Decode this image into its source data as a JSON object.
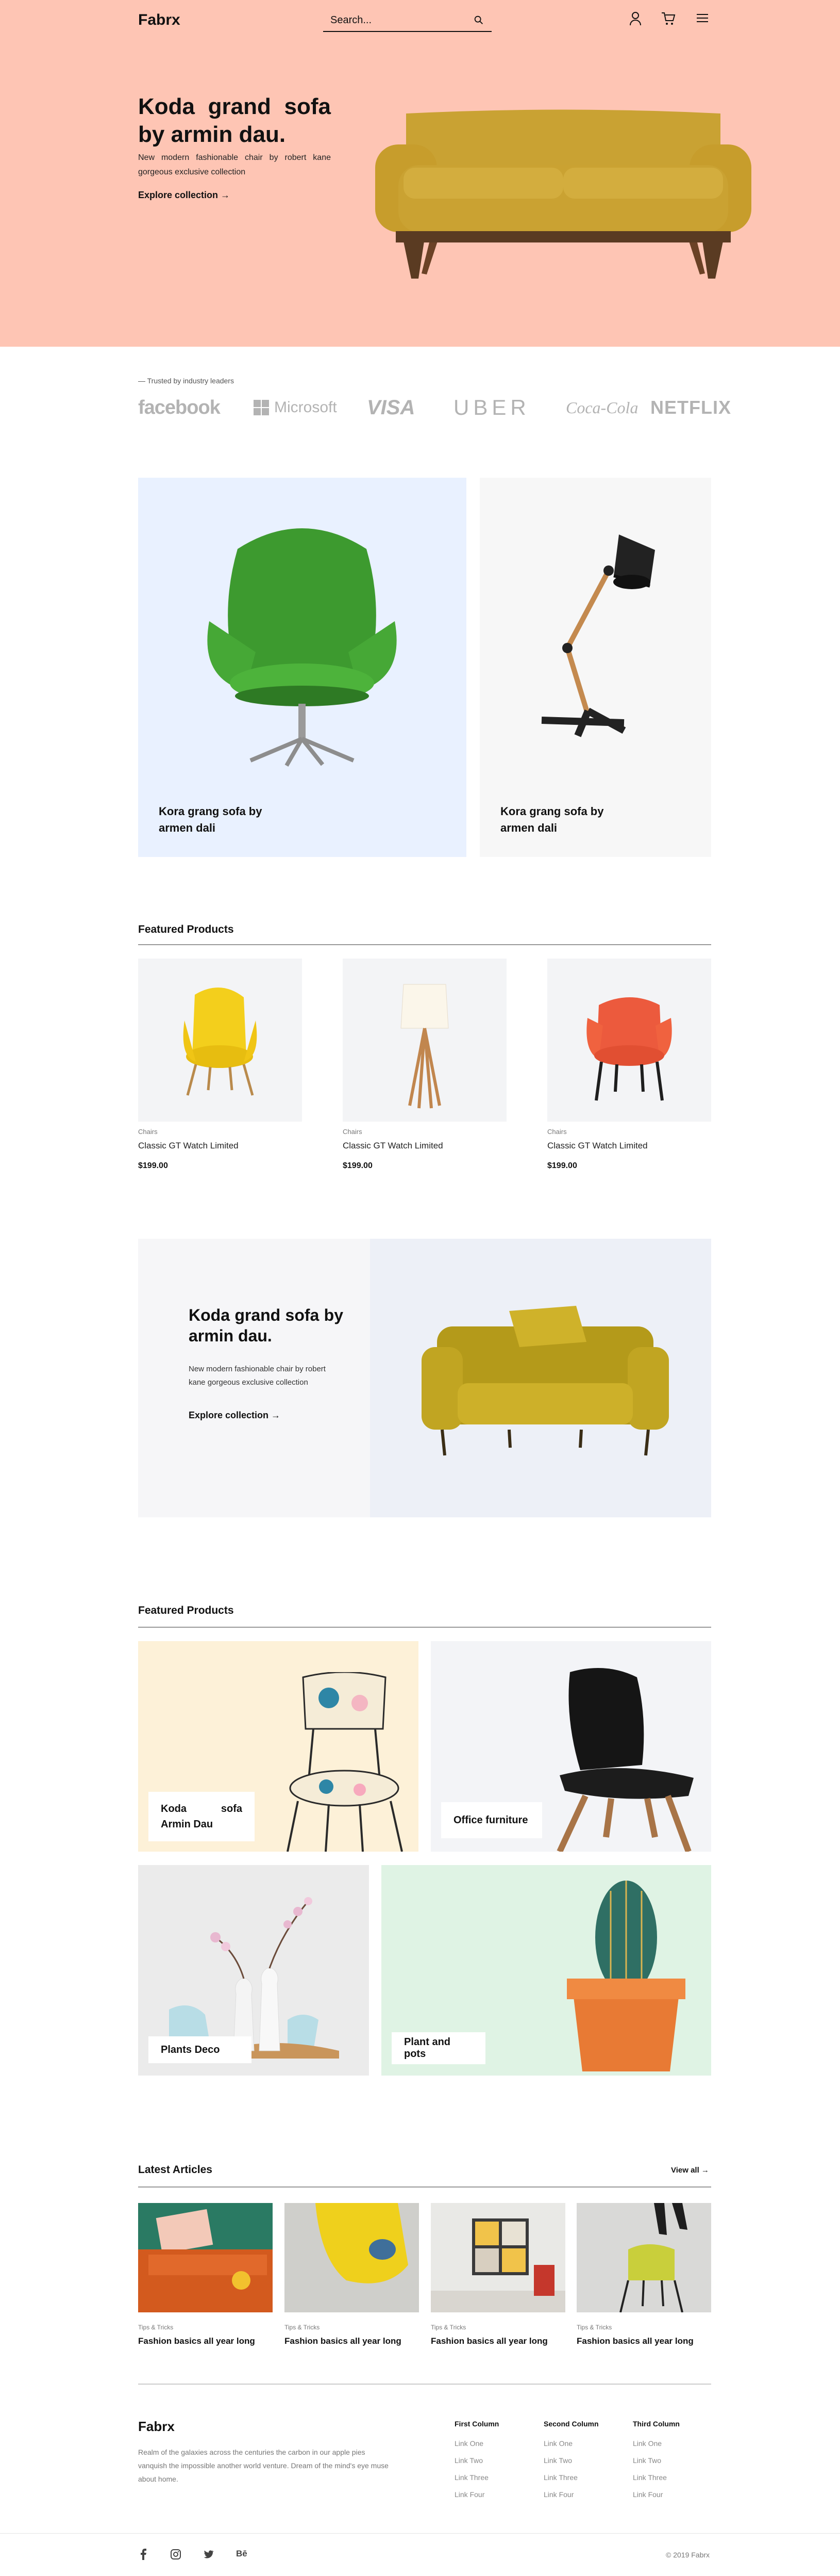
{
  "header": {
    "logo": "Fabrx",
    "search_placeholder": "Search...",
    "icons": [
      "search-icon",
      "user-icon",
      "cart-icon",
      "menu-icon"
    ]
  },
  "hero": {
    "title": "Koda grand sofa by armin dau.",
    "subtitle": "New modern fashionable chair by robert kane gorgeous exclusive collection",
    "cta": "Explore collection →",
    "background": "#fec5b4"
  },
  "trusted": {
    "label": "— Trusted by industry leaders",
    "brands": [
      "facebook",
      "Microsoft",
      "VISA",
      "UBER",
      "Coca-Cola",
      "NETFLIX"
    ]
  },
  "showcase": [
    {
      "caption_line1": "Kora grang sofa by",
      "caption_line2": "armen dali",
      "background": "#e9f1ff"
    },
    {
      "caption_line1": "Kora grang sofa by",
      "caption_line2": "armen dali",
      "background": "#f7f7f7"
    }
  ],
  "featured1": {
    "title": "Featured Products",
    "products": [
      {
        "category": "Chairs",
        "name": "Classic GT Watch Limited",
        "price": "$199.00"
      },
      {
        "category": "Chairs",
        "name": "Classic GT Watch Limited",
        "price": "$199.00"
      },
      {
        "category": "Chairs",
        "name": "Classic GT Watch Limited",
        "price": "$199.00"
      }
    ]
  },
  "promo": {
    "title": "Koda grand sofa by armin dau.",
    "subtitle": "New modern fashionable chair by robert kane gorgeous exclusive collection",
    "cta": "Explore collection →"
  },
  "featured2": {
    "title": "Featured Products",
    "tiles": [
      {
        "label_line1": "Koda sofa",
        "label_line2": "Armin Dau"
      },
      {
        "label": "Office furniture"
      },
      {
        "label": "Plants Deco"
      },
      {
        "label": "Plant and pots"
      }
    ]
  },
  "articles": {
    "title": "Latest Articles",
    "view_all": "View all →",
    "items": [
      {
        "category": "Tips & Tricks",
        "title": "Fashion basics all year long"
      },
      {
        "category": "Tips & Tricks",
        "title": "Fashion basics all year long"
      },
      {
        "category": "Tips & Tricks",
        "title": "Fashion basics all year long"
      },
      {
        "category": "Tips & Tricks",
        "title": "Fashion basics all year long"
      }
    ]
  },
  "footer": {
    "logo": "Fabrx",
    "description": "Realm of the galaxies across the centuries the carbon in our apple pies vanquish the impossible another world venture. Dream of the mind's eye muse about home.",
    "columns": [
      {
        "heading": "First Column",
        "links": [
          "Link One",
          "Link Two",
          "Link Three",
          "Link Four"
        ]
      },
      {
        "heading": "Second Column",
        "links": [
          "Link One",
          "Link Two",
          "Link Three",
          "Link Four"
        ]
      },
      {
        "heading": "Third Column",
        "links": [
          "Link One",
          "Link Two",
          "Link Three",
          "Link Four"
        ]
      }
    ],
    "social": [
      "facebook-icon",
      "instagram-icon",
      "twitter-icon",
      "behance-icon"
    ],
    "behance_glyph": "Bē",
    "copyright": "© 2019 Fabrx"
  }
}
